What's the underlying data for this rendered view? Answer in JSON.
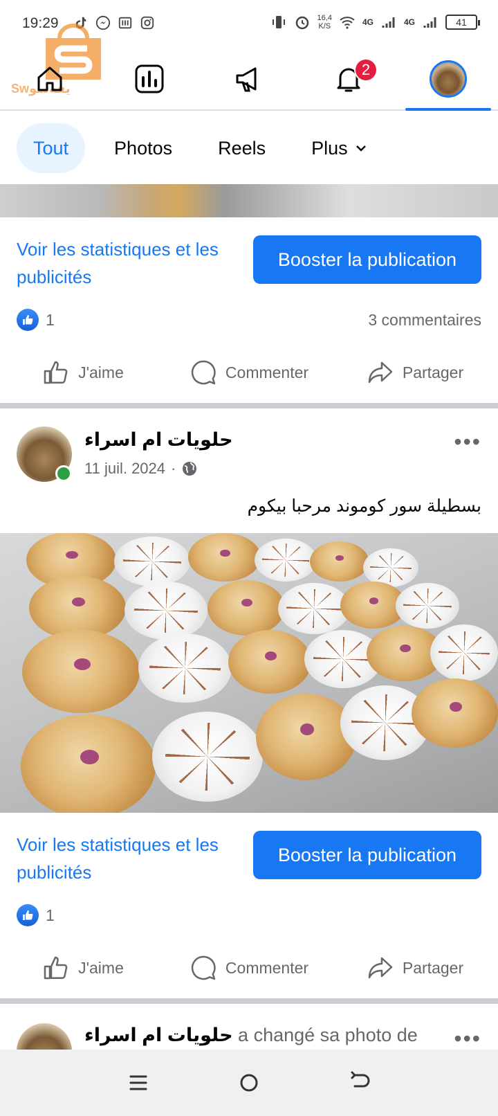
{
  "status_bar": {
    "time": "19:29",
    "net_speed_value": "16,4",
    "net_speed_unit": "K/S",
    "net_type_1": "4G",
    "net_type_2": "4G",
    "battery": "41"
  },
  "watermark": {
    "text": "Swيقةسو",
    "brand_color": "#f08c28"
  },
  "top_nav": {
    "items": [
      {
        "icon": "home-icon"
      },
      {
        "icon": "insights-icon"
      },
      {
        "icon": "megaphone-icon"
      },
      {
        "icon": "bell-icon",
        "badge": "2"
      },
      {
        "icon": "profile-avatar"
      }
    ],
    "accent": "#1877f2"
  },
  "filters": {
    "tabs": [
      {
        "label": "Tout",
        "active": true
      },
      {
        "label": "Photos"
      },
      {
        "label": "Reels"
      },
      {
        "label": "Plus"
      }
    ]
  },
  "post1": {
    "stats_link": "Voir les statistiques et les publicités",
    "boost_label": "Booster la publication",
    "like_count": "1",
    "comments": "3 commentaires",
    "like_label": "J'aime",
    "comment_label": "Commenter",
    "share_label": "Partager"
  },
  "post2": {
    "page_name": "حلويات ام اسراء",
    "date": "11 juil. 2024",
    "separator": "·",
    "text": "بسطيلة سور كوموند مرحبا بيكوم",
    "stats_link": "Voir les statistiques et les publicités",
    "boost_label": "Booster la publication",
    "like_count": "1",
    "like_label": "J'aime",
    "comment_label": "Commenter",
    "share_label": "Partager",
    "more": "•••"
  },
  "post3": {
    "page_name": "حلويات ام اسراء",
    "action": "a changé sa photo de",
    "more": "•••"
  },
  "system_nav": {
    "icons": [
      "recents-icon",
      "home-circle-icon",
      "back-icon"
    ]
  }
}
